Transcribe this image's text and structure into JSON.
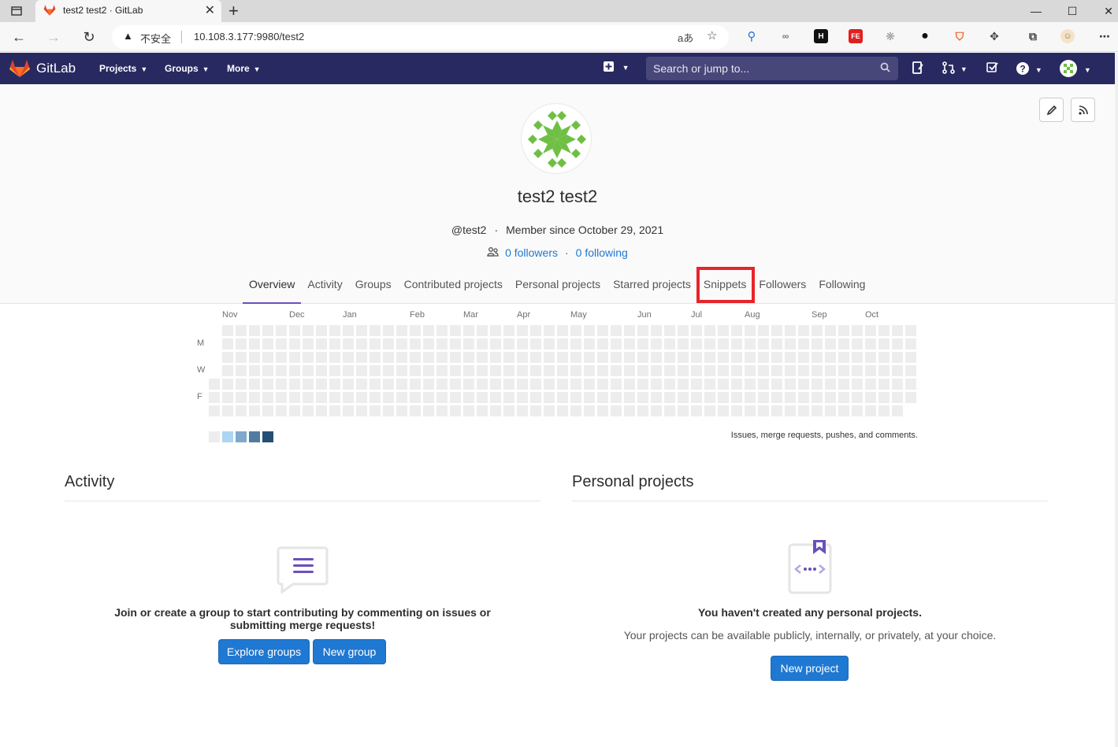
{
  "browser": {
    "tab_title": "test2 test2 · GitLab",
    "tab_close": "✕",
    "new_tab": "+",
    "insecure_label": "不安全",
    "url": "10.108.3.177:9980/test2",
    "window_controls": [
      "—",
      "☐",
      "✕"
    ]
  },
  "header": {
    "brand": "GitLab",
    "menus": [
      "Projects",
      "Groups",
      "More"
    ],
    "search_placeholder": "Search or jump to..."
  },
  "profile": {
    "name": "test2 test2",
    "username": "@test2",
    "member_since": "Member since October 29, 2021",
    "followers": "0 followers",
    "following": "0 following"
  },
  "tabs": [
    "Overview",
    "Activity",
    "Groups",
    "Contributed projects",
    "Personal projects",
    "Starred projects",
    "Snippets",
    "Followers",
    "Following"
  ],
  "calendar": {
    "months": [
      "Nov",
      "Dec",
      "Jan",
      "Feb",
      "Mar",
      "Apr",
      "May",
      "Jun",
      "Jul",
      "Aug",
      "Sep",
      "Oct"
    ],
    "days": [
      "M",
      "W",
      "F"
    ],
    "note": "Issues, merge requests, pushes, and comments.",
    "legend_colors": [
      "#ededed",
      "#acd5f2",
      "#7fa8c9",
      "#527ba0",
      "#254e77"
    ]
  },
  "activity": {
    "title": "Activity",
    "empty_text": "Join or create a group to start contributing by commenting on issues or submitting merge requests!",
    "explore_button": "Explore groups",
    "new_group_button": "New group"
  },
  "personal_projects": {
    "title": "Personal projects",
    "empty_text": "You haven't created any personal projects.",
    "empty_sub": "Your projects can be available publicly, internally, or privately, at your choice.",
    "new_project_button": "New project"
  },
  "colors": {
    "header_bg": "#292961",
    "accent": "#1f78d1",
    "tab_active": "#6b4fbb",
    "highlight": "#e8242b",
    "avatar_green": "#6fbf44"
  }
}
